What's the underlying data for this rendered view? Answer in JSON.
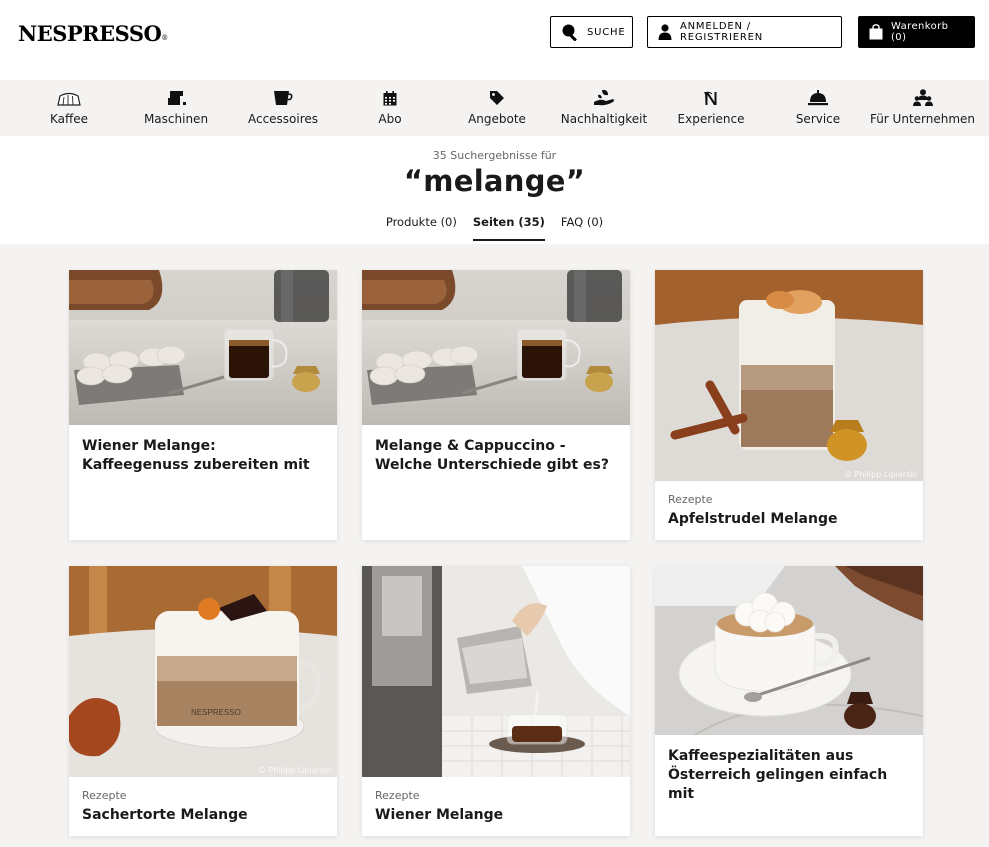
{
  "brand": {
    "logo": "NESPRESSO",
    "reg": "®"
  },
  "header": {
    "search_label": "SUCHE",
    "login_label": "ANMELDEN / REGISTRIEREN",
    "cart_label": "Warenkorb (0)"
  },
  "nav": {
    "items": [
      {
        "label": "Kaffee",
        "icon": "coffee-capsule-icon"
      },
      {
        "label": "Maschinen",
        "icon": "machine-icon"
      },
      {
        "label": "Accessoires",
        "icon": "cup-icon"
      },
      {
        "label": "Abo",
        "icon": "calendar-icon"
      },
      {
        "label": "Angebote",
        "icon": "tag-icon"
      },
      {
        "label": "Nachhaltigkeit",
        "icon": "leaf-hand-icon"
      },
      {
        "label": "Experience",
        "icon": "nespresso-n-icon"
      },
      {
        "label": "Service",
        "icon": "service-bell-icon"
      },
      {
        "label": "Für Unternehmen",
        "icon": "business-people-icon"
      }
    ]
  },
  "search": {
    "results_count": "35 Suchergebnisse für",
    "query": "“melange”",
    "tabs": [
      {
        "label": "Produkte (0)",
        "active": false
      },
      {
        "label": "Seiten (35)",
        "active": true
      },
      {
        "label": "FAQ (0)",
        "active": false
      }
    ]
  },
  "cards": [
    {
      "category": "",
      "title": "Wiener Melange: Kaffeegenuss zubereiten mit",
      "image": "cookies-espresso-photo",
      "credit": ""
    },
    {
      "category": "",
      "title": "Melange & Cappuccino - Welche Unterschiede gibt es?",
      "image": "cookies-espresso-photo",
      "credit": ""
    },
    {
      "category": "Rezepte",
      "title": "Apfelstrudel Melange",
      "image": "cinnamon-latte-photo",
      "credit": "© Philipp Lipiarski"
    },
    {
      "category": "Rezepte",
      "title": "Sachertorte Melange",
      "image": "sachertorte-latte-photo",
      "credit": "© Philipp Lipiarski"
    },
    {
      "category": "Rezepte",
      "title": "Wiener Melange",
      "image": "milk-pouring-photo",
      "credit": ""
    },
    {
      "category": "",
      "title": "Kaffeespezialitäten aus Österreich gelingen einfach mit",
      "image": "whipped-cream-coffee-photo",
      "credit": ""
    }
  ],
  "colors": {
    "accent": "#000000",
    "background": "#f4f3f1",
    "card": "#ffffff"
  }
}
